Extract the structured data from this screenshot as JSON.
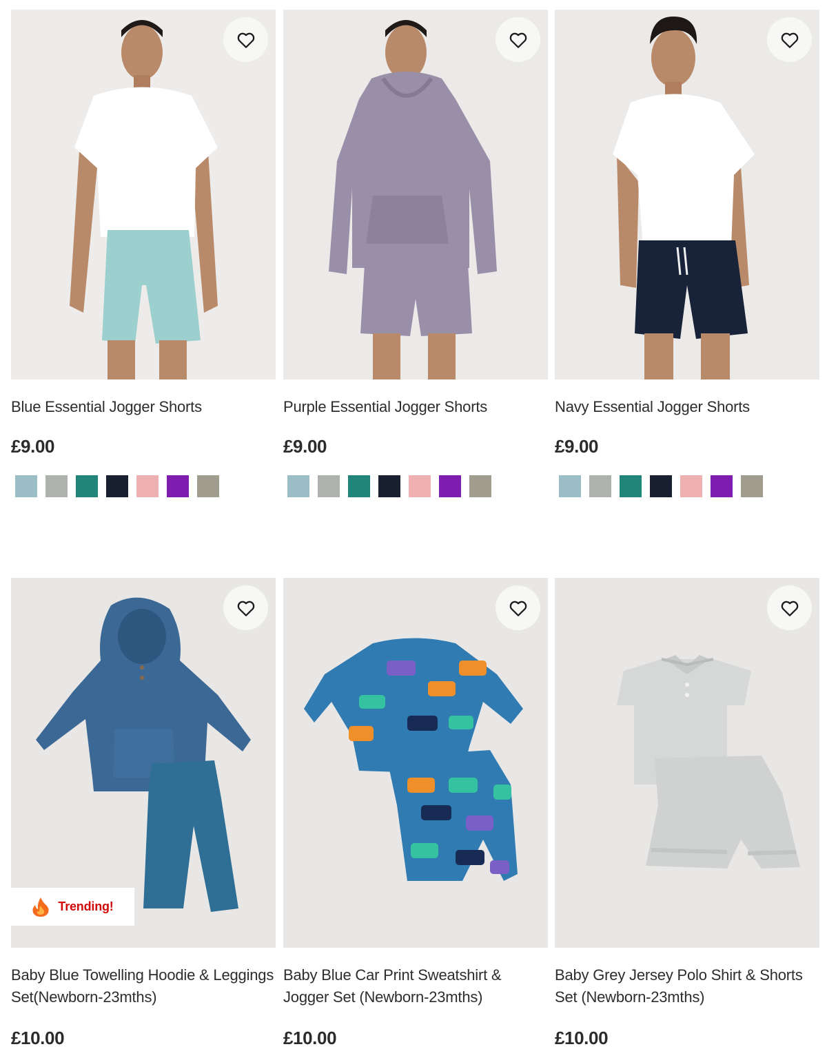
{
  "products": [
    {
      "title": "Blue Essential Jogger Shorts",
      "price": "£9.00",
      "colors": [
        "#9bbec6",
        "#adb2ad",
        "#21857a",
        "#182030",
        "#eeb0b0",
        "#7e1db0",
        "#a19d8e"
      ]
    },
    {
      "title": "Purple Essential Jogger Shorts",
      "price": "£9.00",
      "colors": [
        "#9bbec6",
        "#adb2ad",
        "#21857a",
        "#182030",
        "#eeb0b0",
        "#7e1db0",
        "#a19d8e"
      ]
    },
    {
      "title": "Navy Essential Jogger Shorts",
      "price": "£9.00",
      "colors": [
        "#9bbec6",
        "#adb2ad",
        "#21857a",
        "#182030",
        "#eeb0b0",
        "#7e1db0",
        "#a19d8e"
      ]
    },
    {
      "title": "Baby Blue Towelling Hoodie & Leggings Set(Newborn-23mths)",
      "price": "£10.00",
      "badge": {
        "icon": "flame-icon",
        "label": "Trending!"
      }
    },
    {
      "title": "Baby Blue Car Print Sweatshirt & Jogger Set (Newborn-23mths)",
      "price": "£10.00"
    },
    {
      "title": "Baby Grey Jersey Polo Shirt & Shorts Set (Newborn-23mths)",
      "price": "£10.00"
    }
  ],
  "icons": {
    "favourite": "heart-outline-icon"
  }
}
